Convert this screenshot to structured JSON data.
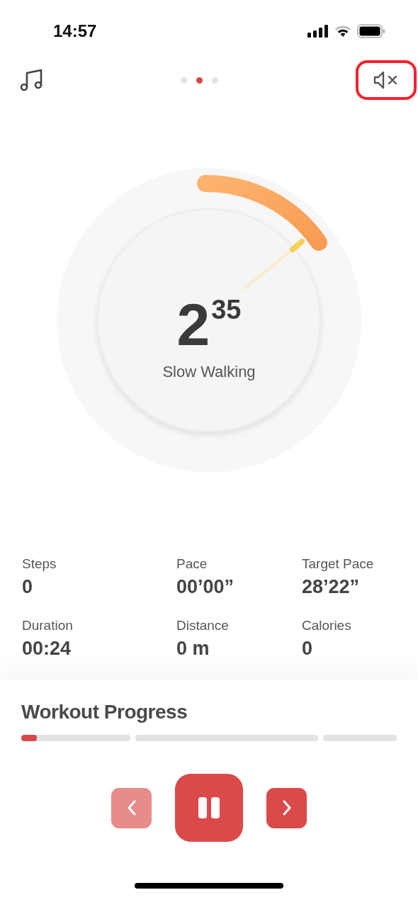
{
  "status_bar": {
    "time": "14:57"
  },
  "top_bar": {
    "page_dots": [
      {
        "selected": false
      },
      {
        "selected": true
      },
      {
        "selected": false
      }
    ],
    "mute_button": {
      "highlighted": true
    }
  },
  "gauge": {
    "value": "2",
    "fraction": "35",
    "label": "Slow Walking"
  },
  "stats": [
    {
      "label": "Steps",
      "value": "0"
    },
    {
      "label": "Pace",
      "value": "00’00”"
    },
    {
      "label": "Target Pace",
      "value": "28’22”"
    },
    {
      "label": "Duration",
      "value": "00:24"
    },
    {
      "label": "Distance",
      "value": "0 m"
    },
    {
      "label": "Calories",
      "value": "0"
    }
  ],
  "workout_progress": {
    "title": "Workout Progress",
    "segments": [
      {
        "kind": "current",
        "level": 0.14
      },
      {
        "kind": "upcoming"
      },
      {
        "kind": "upcoming"
      }
    ]
  },
  "controls": {
    "previous": {
      "disabled": true
    },
    "pause": {
      "disabled": false
    },
    "next": {
      "disabled": false
    }
  }
}
